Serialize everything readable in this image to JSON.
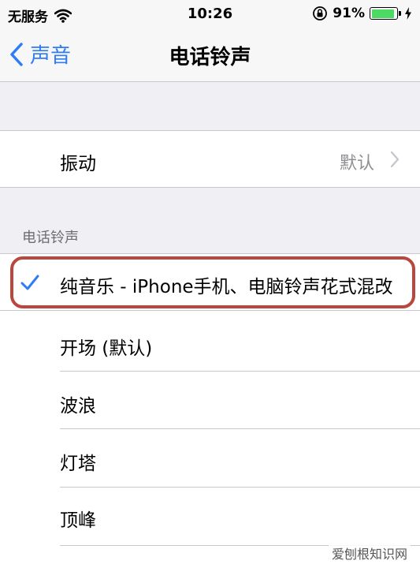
{
  "status_bar": {
    "carrier": "无服务",
    "time": "10:26",
    "battery_percent": "91%",
    "battery_level": 0.91
  },
  "nav": {
    "back_label": "声音",
    "title": "电话铃声"
  },
  "vibration": {
    "label": "振动",
    "value": "默认"
  },
  "ringtones": {
    "header": "电话铃声",
    "items": [
      {
        "label": "纯音乐 - iPhone手机、电脑铃声花式混改",
        "selected": true
      },
      {
        "label": "开场 (默认)",
        "selected": false
      },
      {
        "label": "波浪",
        "selected": false
      },
      {
        "label": "灯塔",
        "selected": false
      },
      {
        "label": "顶峰",
        "selected": false
      }
    ]
  },
  "watermark": "爱刨根知识网",
  "colors": {
    "accent": "#2f7cf6",
    "battery": "#4cd964",
    "highlight": "#b9473f",
    "group_background": "#efeff4"
  }
}
